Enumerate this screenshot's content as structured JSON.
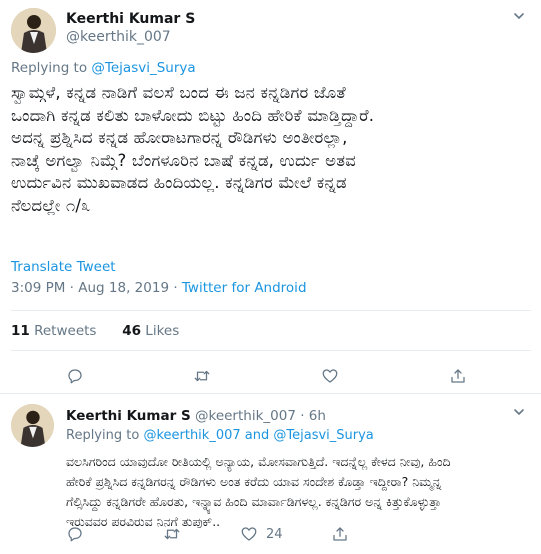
{
  "main_tweet": {
    "author_name": "Keerthi Kumar S",
    "author_handle": "@keerthik_007",
    "replying_to_prefix": "Replying to",
    "replying_to_handle": "@Tejasvi_Surya",
    "text_lines": [
      "ಸ್ವಾಮ್ಗಳೆ, ಕನ್ನಡ ನಾಡಿಗೆ ವಲಸೆ ಬಂದ ಈ ಜನ ಕನ್ನಡಿಗರ ಜೊತೆ",
      "ಒಂದಾಗಿ ಕನ್ನಡ ಕಲಿತು ಬಾಳೋದು ಬಿಟ್ಟು ಹಿಂದಿ ಹೇರಿಕೆ ಮಾಡ್ತಿದ್ದಾರೆ.",
      "ಅದನ್ನ ಪ್ರಶ್ನಿಸಿದ ಕನ್ನಡ ಹೋರಾಟಗಾರನ್ನ ರೌಡಿಗಳು ಅಂತೀರಲ್ಲಾ,",
      "ನಾಚ್ಕೆ ಅಗಲ್ವಾ ನಿಮ್ಗೆ? ಬೆಂಗಳೂರಿನ ಬಾಷೆ ಕನ್ನಡ, ಉರ್ದು ಅತವ",
      "ಉರ್ದುವಿನ ಮುಖವಾಡದ ಹಿಂದಿಯಲ್ಲ. ಕನ್ನಡಿಗರ ಮೇಲೆ ಕನ್ನಡ",
      "ನೆಲದಲ್ಲೇ ೧/೩"
    ],
    "translate_label": "Translate Tweet",
    "timestamp": "3:09 PM · Aug 18, 2019 · ",
    "source": "Twitter for Android",
    "retweets_count": "11",
    "retweets_label": "Retweets",
    "likes_count": "46",
    "likes_label": "Likes"
  },
  "reply_tweet": {
    "author_name": "Keerthi Kumar S",
    "author_handle": "@keerthik_007",
    "time_ago": "· 6h",
    "replying_to_prefix": "Replying to",
    "replying_to_handle_1": "@keerthik_007",
    "and_label": "and",
    "replying_to_handle_2": "@Tejasvi_Surya",
    "text_lines": [
      "ವಲಸಿಗರಿಂದ ಯಾವುದೋ ರೀತಿಯಲ್ಲಿ ಅನ್ಯಾಯ, ಮೋಸವಾಗುತ್ತಿದೆ. ಇದನ್ನೆಲ್ಲ ಕೇಳದ ನೀವು, ಹಿಂದಿ",
      "ಹೇರಿಕೆ ಪ್ರಶ್ನಿಸಿದ ಕನ್ನಡಿಗರನ್ನ ರೌಡಿಗಳು ಅಂತ ಕರೆದು ಯಾವ ಸಂದೇಶ ಕೊಡ್ತಾ ಇದ್ದೀರಾ? ನಿಮ್ಮನ್ನ",
      "ಗೆಲ್ಸಿಸಿದ್ದು ಕನ್ನಡಿಗರೇ ಹೊರತು, ಇನ್ನ್ಯಾವ ಹಿಂದಿ ಮಾರ್ವಾಡಿಗಳಲ್ಲ. ಕನ್ನಡಿಗರ ಅನ್ನ ಕಿತ್ತುಕೊಳ್ಳುತ್ತಾ",
      "ಇರುವವರ ಪರವಿರುವ ನಿನಗೆ ತುಪುಕ್.."
    ],
    "retweet_count": "",
    "like_count": "24"
  },
  "colors": {
    "link": "#1b95e0",
    "secondary_text": "#657786",
    "primary_text": "#14171a",
    "divider": "#e6ecf0"
  },
  "icons": {
    "reply": "speech-bubble",
    "retweet": "two-arrows-loop",
    "like": "heart-outline",
    "share": "upload-arrow",
    "more": "chevron-down"
  }
}
